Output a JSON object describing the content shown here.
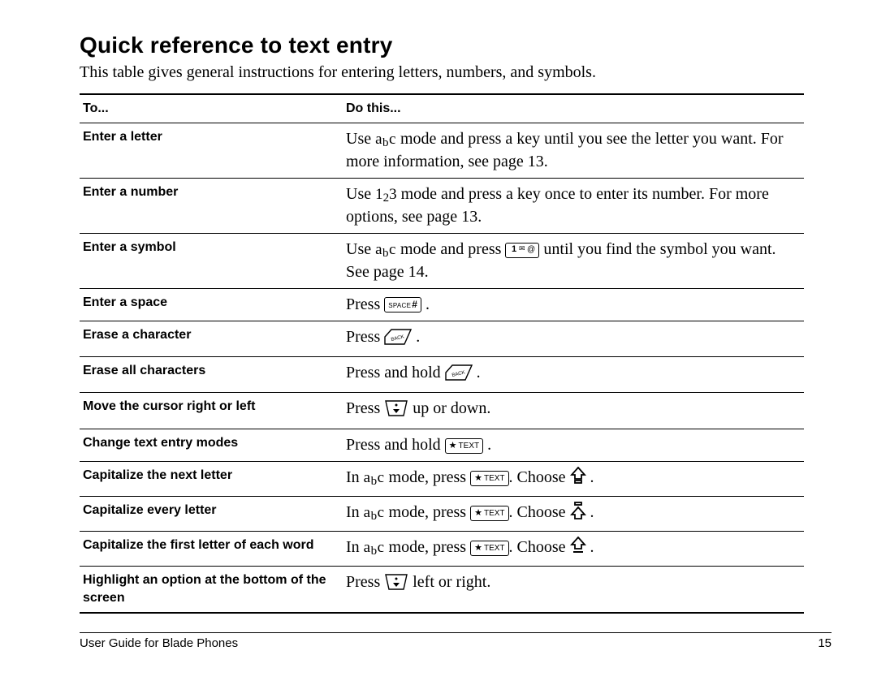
{
  "title": "Quick reference to text entry",
  "intro": "This table gives general instructions for entering letters, numbers, and symbols.",
  "header": {
    "to": "To...",
    "do": "Do this..."
  },
  "rows": {
    "enter_letter": {
      "to": "Enter a letter",
      "pre": "Use ",
      "mode": "abc",
      "post": " mode and press a key until you see the letter you want. For more information, see page 13."
    },
    "enter_number": {
      "to": "Enter a number",
      "pre": "Use ",
      "mode": "123",
      "post": " mode and press a key once to enter its number. For more options, see page 13."
    },
    "enter_symbol": {
      "to": "Enter a symbol",
      "pre": "Use ",
      "mode": "abc",
      "mid": " mode and press ",
      "key": "1-key",
      "post": " until you find the symbol you want. See page 14."
    },
    "enter_space": {
      "to": "Enter a space",
      "pre": "Press ",
      "key": "space-hash",
      "post": " ."
    },
    "erase_char": {
      "to": "Erase a character",
      "pre": "Press ",
      "key": "back",
      "post": " ."
    },
    "erase_all": {
      "to": "Erase all characters",
      "pre": "Press and hold ",
      "key": "back",
      "post": " ."
    },
    "move_cursor": {
      "to": "Move the cursor right or left",
      "pre": "Press ",
      "key": "nav",
      "post": " up or down."
    },
    "change_mode": {
      "to": "Change text entry modes",
      "pre": "Press and hold ",
      "key": "star-text",
      "post": " ."
    },
    "cap_next": {
      "to": "Capitalize the next letter",
      "pre": "In ",
      "mode": "abc",
      "mid": " mode, press ",
      "key": "star-text",
      "choose": ". Choose ",
      "icon": "cap-next",
      "post": " ."
    },
    "cap_every": {
      "to": "Capitalize every letter",
      "pre": "In ",
      "mode": "abc",
      "mid": " mode, press ",
      "key": "star-text",
      "choose": ". Choose ",
      "icon": "cap-every",
      "post": " ."
    },
    "cap_first": {
      "to": "Capitalize the first letter of each word",
      "pre": "In ",
      "mode": "abc",
      "mid": " mode, press ",
      "key": "star-text",
      "choose": ". Choose ",
      "icon": "cap-first",
      "post": " ."
    },
    "highlight": {
      "to": "Highlight an option at the bottom of the screen",
      "pre": "Press ",
      "key": "nav",
      "post": " left or right."
    }
  },
  "footer": {
    "left": "User Guide for Blade Phones",
    "right": "15"
  },
  "keys": {
    "star_text_label": "TEXT"
  }
}
